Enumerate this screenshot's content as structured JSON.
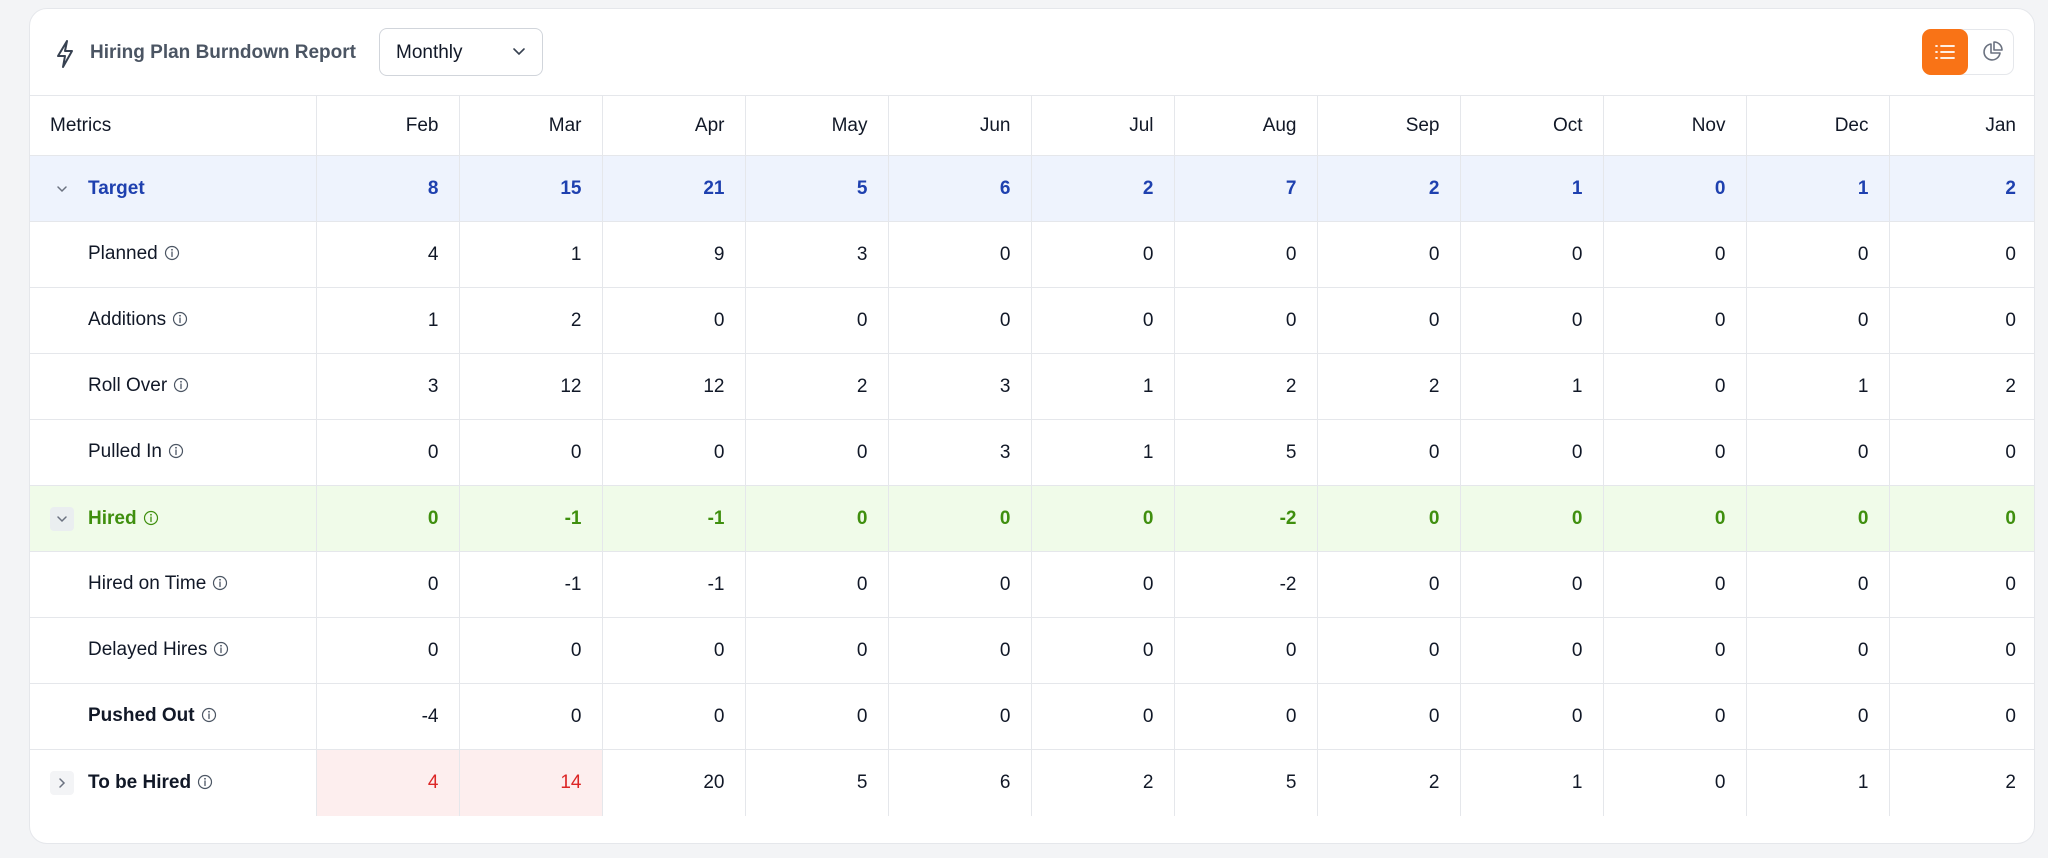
{
  "header": {
    "title": "Hiring Plan Burndown Report",
    "period": "Monthly"
  },
  "colors": {
    "accent": "#f97316",
    "target": "#1e40af",
    "hired": "#3f8f0e",
    "warning": "#dc2626"
  },
  "table": {
    "metric_header": "Metrics",
    "months": [
      "Feb",
      "Mar",
      "Apr",
      "May",
      "Jun",
      "Jul",
      "Aug",
      "Sep",
      "Oct",
      "Nov",
      "Dec",
      "Jan"
    ],
    "rows": [
      {
        "label": "Target",
        "values": [
          "8",
          "15",
          "21",
          "5",
          "6",
          "2",
          "7",
          "2",
          "1",
          "0",
          "1",
          "2"
        ]
      },
      {
        "label": "Planned",
        "values": [
          "4",
          "1",
          "9",
          "3",
          "0",
          "0",
          "0",
          "0",
          "0",
          "0",
          "0",
          "0"
        ]
      },
      {
        "label": "Additions",
        "values": [
          "1",
          "2",
          "0",
          "0",
          "0",
          "0",
          "0",
          "0",
          "0",
          "0",
          "0",
          "0"
        ]
      },
      {
        "label": "Roll Over",
        "values": [
          "3",
          "12",
          "12",
          "2",
          "3",
          "1",
          "2",
          "2",
          "1",
          "0",
          "1",
          "2"
        ]
      },
      {
        "label": "Pulled In",
        "values": [
          "0",
          "0",
          "0",
          "0",
          "3",
          "1",
          "5",
          "0",
          "0",
          "0",
          "0",
          "0"
        ]
      },
      {
        "label": "Hired",
        "values": [
          "0",
          "-1",
          "-1",
          "0",
          "0",
          "0",
          "-2",
          "0",
          "0",
          "0",
          "0",
          "0"
        ]
      },
      {
        "label": "Hired on Time",
        "values": [
          "0",
          "-1",
          "-1",
          "0",
          "0",
          "0",
          "-2",
          "0",
          "0",
          "0",
          "0",
          "0"
        ]
      },
      {
        "label": "Delayed Hires",
        "values": [
          "0",
          "0",
          "0",
          "0",
          "0",
          "0",
          "0",
          "0",
          "0",
          "0",
          "0",
          "0"
        ]
      },
      {
        "label": "Pushed Out",
        "values": [
          "-4",
          "0",
          "0",
          "0",
          "0",
          "0",
          "0",
          "0",
          "0",
          "0",
          "0",
          "0"
        ]
      },
      {
        "label": "To be Hired",
        "values": [
          "4",
          "14",
          "20",
          "5",
          "6",
          "2",
          "5",
          "2",
          "1",
          "0",
          "1",
          "2"
        ]
      }
    ]
  }
}
